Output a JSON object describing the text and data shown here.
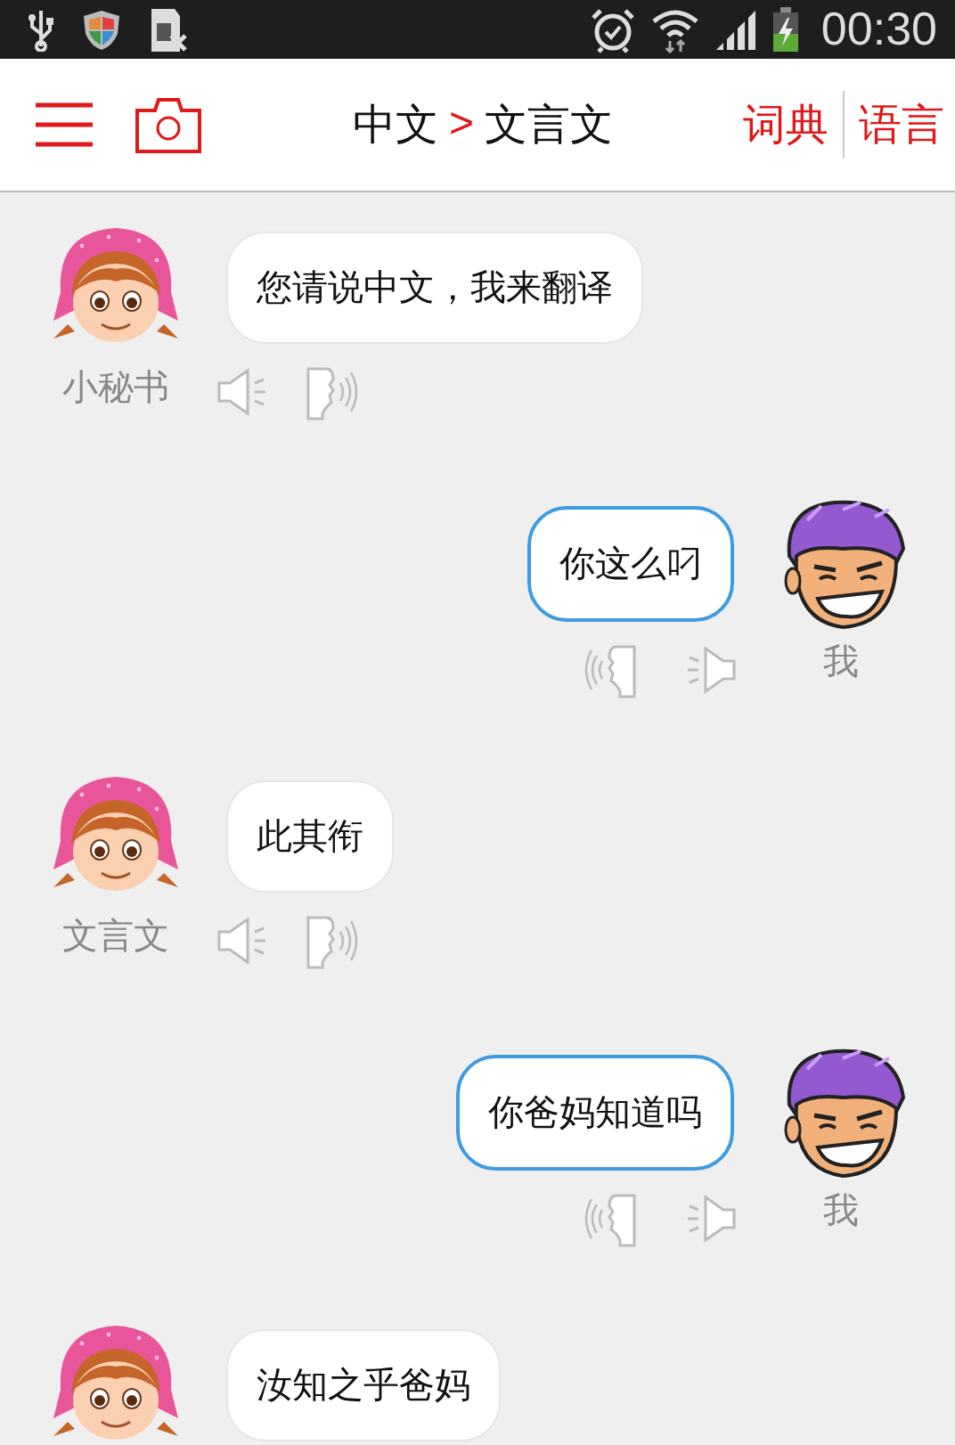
{
  "status_bar": {
    "time": "00:30"
  },
  "header": {
    "source_language": "中文",
    "separator": ">",
    "target_language": "文言文",
    "buttons": [
      "词典",
      "语言"
    ]
  },
  "messages": [
    {
      "kind": "left",
      "name": "小秘书",
      "text": "您请说中文，我来翻译"
    },
    {
      "kind": "right",
      "name": "我",
      "text": "你这么叼"
    },
    {
      "kind": "left",
      "name": "文言文",
      "text": "此其衔"
    },
    {
      "kind": "right",
      "name": "我",
      "text": "你爸妈知道吗"
    },
    {
      "kind": "left",
      "text": "汝知之乎爸妈"
    }
  ]
}
